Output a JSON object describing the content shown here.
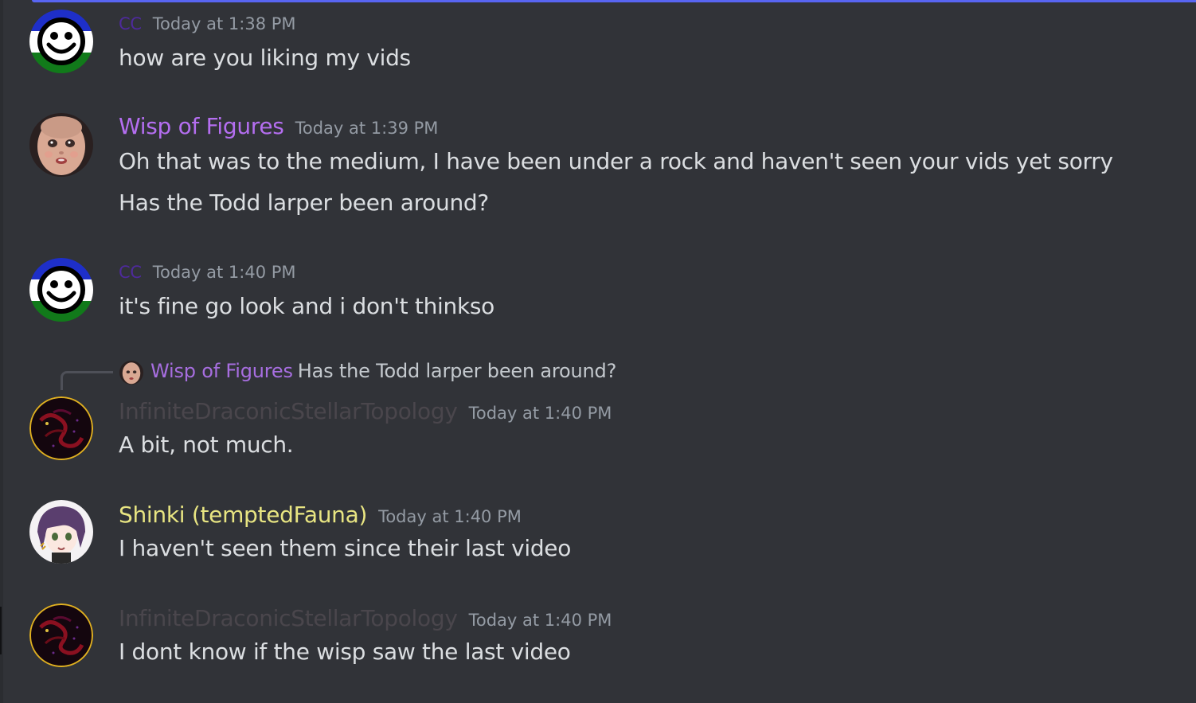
{
  "colors": {
    "background": "#313338",
    "accent": "#5865f2",
    "cc_name": "#4e2a9c",
    "wisp_name": "#b46ef0",
    "infinite_name": "#4a464c",
    "shinki_name": "#e8e582",
    "timestamp": "#949ba4",
    "text": "#dbdee1"
  },
  "messages": [
    {
      "author": "CC",
      "avatar": "smiley-tricolor-avatar",
      "timestamp": "Today at 1:38 PM",
      "lines": [
        "how are you liking my vids"
      ]
    },
    {
      "author": "Wisp of Figures",
      "avatar": "doll-face-avatar",
      "timestamp": "Today at 1:39 PM",
      "lines": [
        "Oh that was to the medium, I have been under a rock and haven't seen your vids yet sorry",
        "Has the Todd larper been around?"
      ]
    },
    {
      "author": "CC",
      "avatar": "smiley-tricolor-avatar",
      "timestamp": "Today at 1:40 PM",
      "lines": [
        "it's fine go look and i don't thinkso"
      ]
    },
    {
      "author": "InfiniteDraconicStellarTopology",
      "avatar": "dark-dragon-avatar",
      "timestamp": "Today at 1:40 PM",
      "reply": {
        "author": "Wisp of Figures",
        "content": "Has the Todd larper been around?"
      },
      "lines": [
        "A bit, not much."
      ]
    },
    {
      "author": "Shinki (temptedFauna)",
      "avatar": "anime-girl-avatar",
      "timestamp": "Today at 1:40 PM",
      "lines": [
        "I haven't seen them since their last video"
      ]
    },
    {
      "author": "InfiniteDraconicStellarTopology",
      "avatar": "dark-dragon-avatar",
      "timestamp": "Today at 1:40 PM",
      "lines": [
        "I dont know if the wisp saw the last video"
      ]
    }
  ]
}
